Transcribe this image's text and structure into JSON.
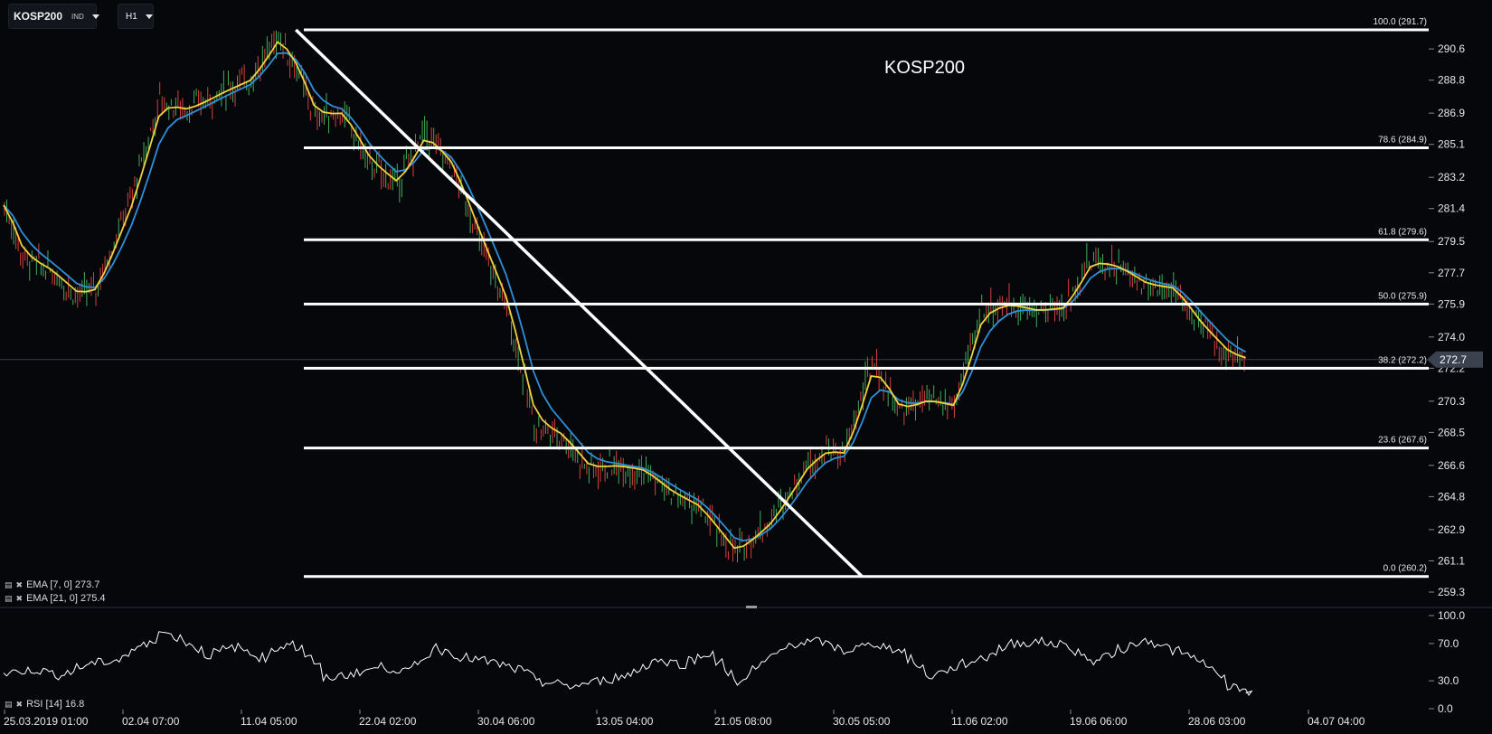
{
  "header": {
    "symbol": "KOSP200",
    "instrument_class": "IND",
    "timeframe": "H1"
  },
  "indicators": {
    "ema7_label": "EMA [7, 0] 273.7",
    "ema21_label": "EMA [21, 0] 275.4",
    "rsi_label": "RSI [14] 16.8"
  },
  "colors": {
    "background": "#05070b",
    "ema7": "#f0d23c",
    "ema21": "#2f8fd8",
    "candle_up": "#3fae5a",
    "candle_down": "#d6413c",
    "fib_line": "#ffffff",
    "rsi_line": "#ffffff",
    "price_tag": "#3a4250"
  },
  "chart_data": [
    {
      "type": "candlestick",
      "title": "KOSP200",
      "y_ticks": [
        "290.6",
        "288.8",
        "286.9",
        "285.1",
        "283.2",
        "281.4",
        "279.5",
        "277.7",
        "275.9",
        "274.0",
        "272.2",
        "270.3",
        "268.5",
        "266.6",
        "264.8",
        "262.9",
        "261.1",
        "259.3"
      ],
      "ylim": [
        259.3,
        291.7
      ],
      "current_price": "272.7",
      "x_tick_labels": [
        "25.03.2019  01:00",
        "02.04  07:00",
        "11.04  05:00",
        "22.04  02:00",
        "30.04  06:00",
        "13.05  04:00",
        "21.05  08:00",
        "30.05  05:00",
        "11.06  02:00",
        "19.06  06:00",
        "28.06  03:00",
        "04.07  04:00"
      ],
      "fibonacci_levels": [
        {
          "label": "100.0 (291.7)",
          "price": 291.7
        },
        {
          "label": "78.6 (284.9)",
          "price": 284.9
        },
        {
          "label": "61.8 (279.6)",
          "price": 279.6
        },
        {
          "label": "50.0 (275.9)",
          "price": 275.9
        },
        {
          "label": "38.2 (272.2)",
          "price": 272.2
        },
        {
          "label": "23.6 (267.6)",
          "price": 267.6
        },
        {
          "label": "0.0 (260.2)",
          "price": 260.2
        }
      ],
      "price_series_keypoints": {
        "x_index": [
          0,
          2,
          5,
          8,
          10,
          14,
          17,
          20,
          24,
          27,
          30,
          32,
          34,
          37,
          40,
          43,
          46,
          49,
          52,
          55,
          58,
          61,
          64,
          67,
          70,
          73,
          76,
          80,
          84,
          88,
          90,
          92,
          95,
          98,
          101,
          104,
          107,
          110,
          113,
          116,
          119,
          122,
          125,
          128,
          131,
          134,
          136
        ],
        "close": [
          281.6,
          278.6,
          277.8,
          276.4,
          276.8,
          282.2,
          287.6,
          287.1,
          288.2,
          288.9,
          291.4,
          289.4,
          286.7,
          286.9,
          284.0,
          282.8,
          285.8,
          283.8,
          279.6,
          275.7,
          269.0,
          268.3,
          266.4,
          266.6,
          266.3,
          265.0,
          264.2,
          261.5,
          263.5,
          266.8,
          267.5,
          267.3,
          272.6,
          269.7,
          270.4,
          270.0,
          275.6,
          275.9,
          275.5,
          275.7,
          278.5,
          278.0,
          277.0,
          276.8,
          274.6,
          273.0,
          272.7
        ]
      },
      "trendline": {
        "from": {
          "x_index": 32,
          "price": 291.7
        },
        "to": {
          "x_index": 94,
          "price": 260.2
        }
      },
      "ema_periods": [
        7,
        21
      ]
    },
    {
      "type": "line",
      "title": "",
      "name": "RSI [14]",
      "y_ticks": [
        "100.0",
        "70.0",
        "30.0",
        "0.0"
      ],
      "ylim": [
        0,
        100
      ],
      "last_value": 16.8,
      "x_index": [
        0,
        3,
        6,
        9,
        12,
        15,
        17,
        19,
        22,
        25,
        28,
        31,
        33,
        35,
        38,
        41,
        44,
        47,
        50,
        53,
        56,
        59,
        62,
        65,
        68,
        71,
        74,
        77,
        80,
        83,
        86,
        89,
        92,
        95,
        98,
        101,
        104,
        107,
        110,
        113,
        116,
        119,
        122,
        125,
        128,
        131,
        134,
        136
      ],
      "values": [
        38,
        42,
        36,
        48,
        52,
        68,
        82,
        76,
        58,
        66,
        55,
        72,
        58,
        32,
        38,
        45,
        40,
        66,
        55,
        50,
        42,
        28,
        24,
        30,
        36,
        52,
        48,
        60,
        28,
        50,
        70,
        72,
        62,
        70,
        62,
        35,
        45,
        55,
        70,
        72,
        68,
        50,
        64,
        74,
        62,
        50,
        24,
        17
      ]
    }
  ]
}
